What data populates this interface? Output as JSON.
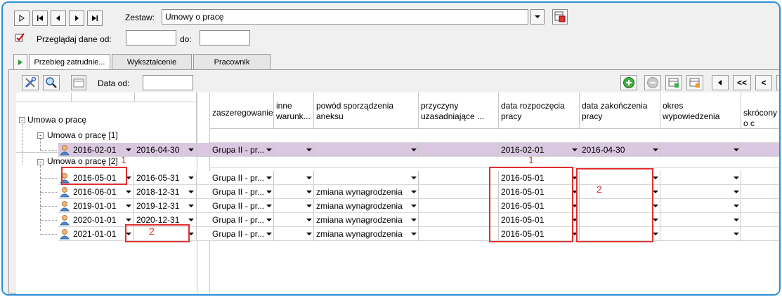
{
  "top": {
    "zestaw_label": "Zestaw:",
    "zestaw_value": "Umowy o pracę",
    "browse_label": "Przeglądaj dane od:",
    "browse_from": "",
    "do_label": "do:",
    "browse_to": ""
  },
  "tabs": [
    {
      "label": "Przebieg zatrudnie..."
    },
    {
      "label": "Wykształcenie"
    },
    {
      "label": "Pracownik"
    }
  ],
  "toolbar": {
    "data_od_label": "Data od:",
    "data_od_value": "",
    "nav": [
      "<<",
      "<"
    ]
  },
  "columns": {
    "tree": "Umowa o pracę",
    "zaszeregowanie": "zaszeregowanie",
    "inne": "inne warunk...",
    "powod": "powód sporządzenia aneksu",
    "przyczyny": "przyczyny uzasadniające ...",
    "start": "data rozpoczęcia pracy",
    "end": "data zakończenia pracy",
    "okres": "okres wypowiedzenia",
    "skrocony": "skrócony o c"
  },
  "groups": [
    {
      "label": "Umowa o pracę [1]"
    },
    {
      "label": "Umowa o pracę [2]"
    }
  ],
  "rows": [
    {
      "from": "2016-02-01",
      "to": "2016-04-30",
      "zasz": "Grupa II - pr...",
      "powod": "",
      "start": "2016-02-01",
      "end": "2016-04-30"
    },
    {
      "from": "2016-05-01",
      "to": "2016-05-31",
      "zasz": "Grupa II - pr...",
      "powod": "",
      "start": "2016-05-01",
      "end": ""
    },
    {
      "from": "2016-06-01",
      "to": "2018-12-31",
      "zasz": "Grupa II - pr...",
      "powod": "zmiana wynagrodzenia",
      "start": "2016-05-01",
      "end": ""
    },
    {
      "from": "2019-01-01",
      "to": "2019-12-31",
      "zasz": "Grupa II - pr...",
      "powod": "zmiana wynagrodzenia",
      "start": "2016-05-01",
      "end": ""
    },
    {
      "from": "2020-01-01",
      "to": "2020-12-31",
      "zasz": "Grupa II - pr...",
      "powod": "zmiana wynagrodzenia",
      "start": "2016-05-01",
      "end": ""
    },
    {
      "from": "2021-01-01",
      "to": "",
      "zasz": "Grupa II - pr...",
      "powod": "zmiana wynagrodzenia",
      "start": "2016-05-01",
      "end": ""
    }
  ],
  "annotations": [
    "1",
    "2",
    "1",
    "2"
  ],
  "colors": {
    "accent": "#2b8fd6",
    "highlight_row": "#d9c8df",
    "annotation": "#e03030"
  }
}
